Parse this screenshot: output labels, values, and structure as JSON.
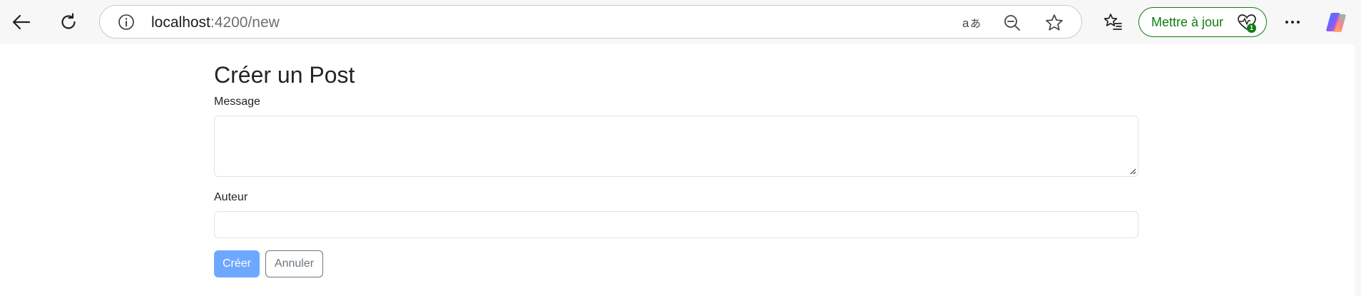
{
  "browser": {
    "back_icon": "arrow-left-icon",
    "reload_icon": "reload-icon",
    "address": {
      "host": "localhost",
      "path": ":4200/new"
    },
    "address_icons": [
      "info-icon",
      "translate-icon",
      "zoom-out-icon",
      "star-icon"
    ],
    "favorites_icon": "favorites-list-icon",
    "update_button": {
      "label": "Mettre à jour",
      "badge": "1"
    },
    "more_icon": "more-icon",
    "copilot_icon": "copilot-icon",
    "accent": "#107c10"
  },
  "form": {
    "title": "Créer un Post",
    "message_label": "Message",
    "message_value": "",
    "author_label": "Auteur",
    "author_value": "",
    "create_label": "Créer",
    "cancel_label": "Annuler",
    "primary_color": "#6ea8fe",
    "secondary_color": "#6c757d"
  }
}
